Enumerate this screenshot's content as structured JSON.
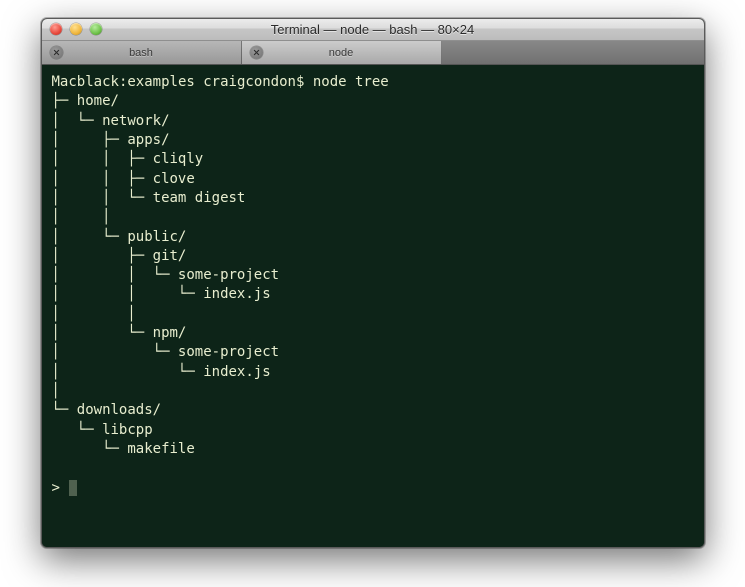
{
  "window": {
    "title": "Terminal — node — bash — 80×24"
  },
  "tabs": [
    {
      "label": "bash",
      "active": false
    },
    {
      "label": "node",
      "active": true
    }
  ],
  "prompt": {
    "host": "Macblack",
    "path": "examples",
    "user": "craigcondon",
    "symbol": "$",
    "command": "node tree"
  },
  "tree_raw": "├─ home/\n│  └─ network/\n│     ├─ apps/\n│     │  ├─ cliqly\n│     │  ├─ clove\n│     │  └─ team digest\n│     │\n│     └─ public/\n│        ├─ git/\n│        │  └─ some-project\n│        │     └─ index.js\n│        │\n│        └─ npm/\n│           └─ some-project\n│              └─ index.js\n│\n└─ downloads/\n   └─ libcpp\n      └─ makefile",
  "tree": [
    {
      "name": "home",
      "type": "dir",
      "children": [
        {
          "name": "network",
          "type": "dir",
          "children": [
            {
              "name": "apps",
              "type": "dir",
              "children": [
                {
                  "name": "cliqly",
                  "type": "file"
                },
                {
                  "name": "clove",
                  "type": "file"
                },
                {
                  "name": "team digest",
                  "type": "file"
                }
              ]
            },
            {
              "name": "public",
              "type": "dir",
              "children": [
                {
                  "name": "git",
                  "type": "dir",
                  "children": [
                    {
                      "name": "some-project",
                      "type": "dir",
                      "children": [
                        {
                          "name": "index.js",
                          "type": "file"
                        }
                      ]
                    }
                  ]
                },
                {
                  "name": "npm",
                  "type": "dir",
                  "children": [
                    {
                      "name": "some-project",
                      "type": "dir",
                      "children": [
                        {
                          "name": "index.js",
                          "type": "file"
                        }
                      ]
                    }
                  ]
                }
              ]
            }
          ]
        }
      ]
    },
    {
      "name": "downloads",
      "type": "dir",
      "children": [
        {
          "name": "libcpp",
          "type": "dir",
          "children": [
            {
              "name": "makefile",
              "type": "file"
            }
          ]
        }
      ]
    }
  ],
  "secondary_prompt": "> "
}
